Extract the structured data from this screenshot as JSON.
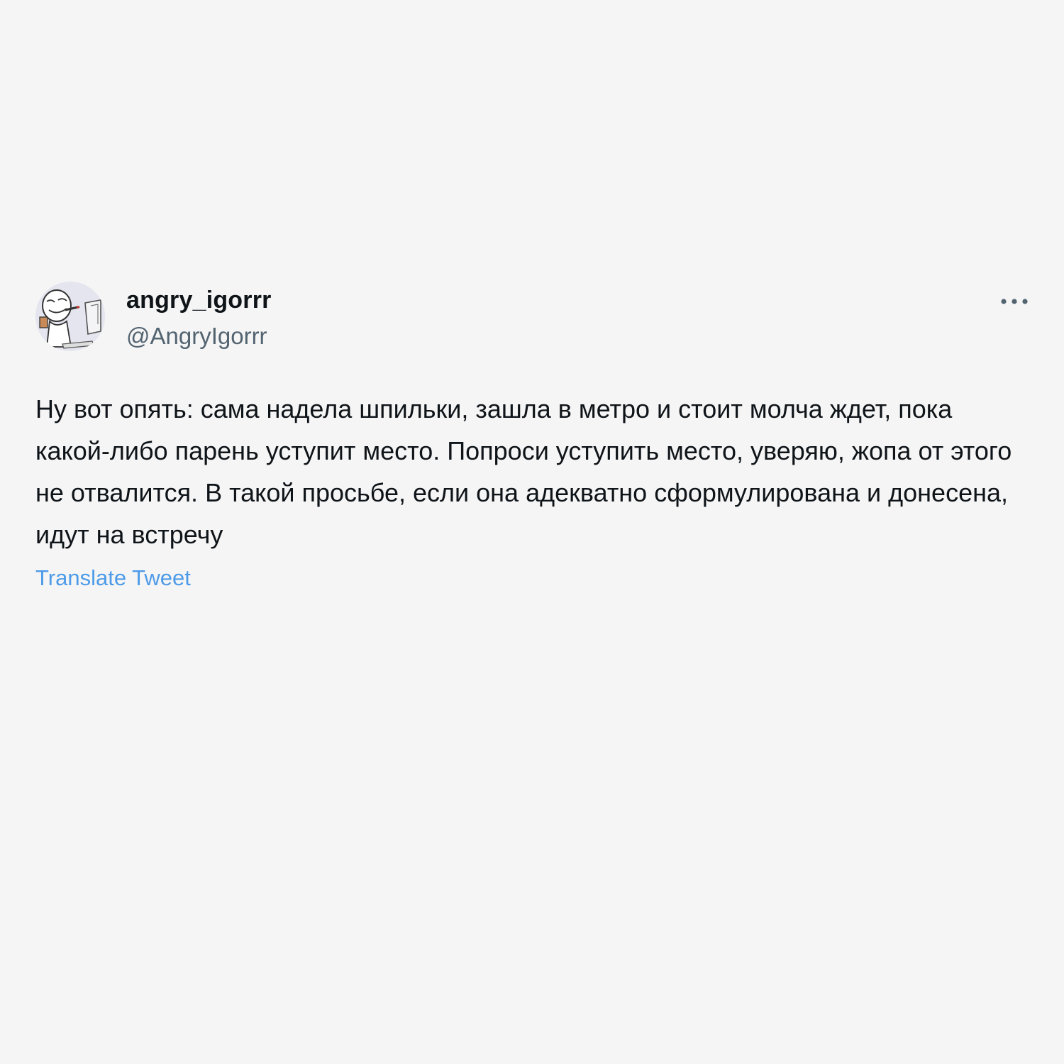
{
  "tweet": {
    "display_name": "angry_igorrr",
    "handle": "@AngryIgorrr",
    "avatar_icon": "cartoon-avatar",
    "more_icon": "more-horizontal-icon",
    "text": "Ну вот опять: сама надела шпильки, зашла в метро и стоит молча ждет, пока какой-либо парень уступит место. Попроси уступить место, уверяю, жопа от этого не отвалится. В такой просьбе, если она адекватно сформулирована и донесена, идут на встречу",
    "translate_label": "Translate Tweet"
  },
  "colors": {
    "background": "#f5f5f5",
    "text": "#0f1419",
    "secondary_text": "#536471",
    "link": "#4d9be8"
  }
}
